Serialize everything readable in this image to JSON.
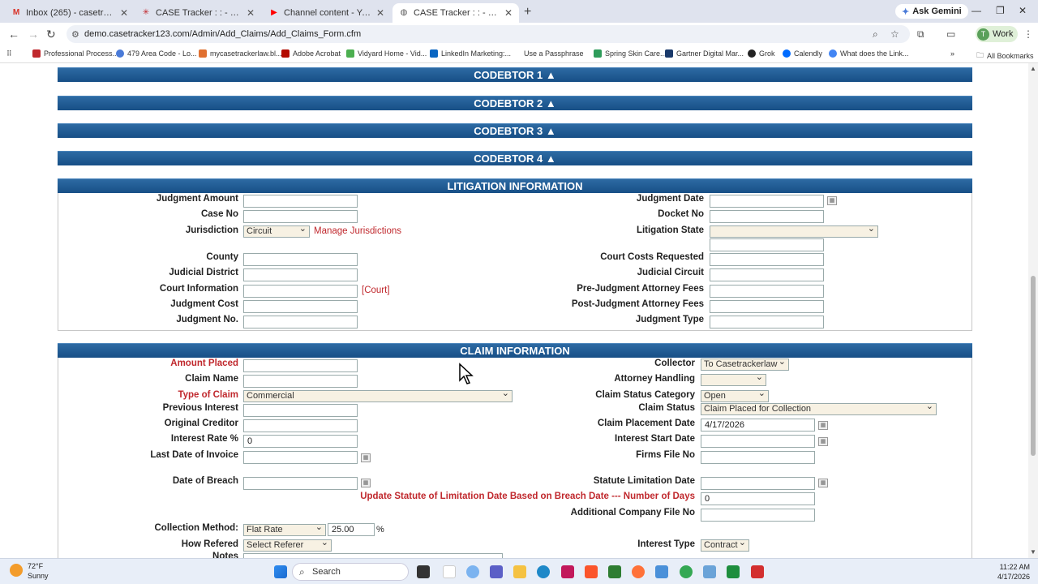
{
  "browser": {
    "tabs": [
      {
        "title": "Inbox (265) - casetrackerlaw@g",
        "icon": "gmail-icon",
        "color": "#d93025"
      },
      {
        "title": "CASE Tracker : : - - - - - - - - - - -",
        "icon": "casetracker-icon",
        "color": "#c0282d"
      },
      {
        "title": "Channel content - YouTube Stu",
        "icon": "youtube-icon",
        "color": "#ff0000"
      },
      {
        "title": "CASE Tracker : : - - - - - - - - - - -",
        "icon": "globe-icon",
        "color": "#555555"
      }
    ],
    "ask_gemini": "Ask Gemini",
    "url": "demo.casetracker123.com/Admin/Add_Claims/Add_Claims_Form.cfm",
    "profile": "Work",
    "profile_initial": "T",
    "bookmarks": [
      "Professional Process...",
      "479 Area Code - Lo...",
      "mycasetrackerlaw.bl...",
      "Adobe Acrobat",
      "Vidyard Home - Vid...",
      "LinkedIn Marketing:...",
      "Use a Passphrase",
      "Spring Skin Care...",
      "Gartner Digital Mar...",
      "Grok",
      "Calendly",
      "What does the Link..."
    ],
    "all_bookmarks": "All Bookmarks"
  },
  "sections": {
    "codebtor1": "CODEBTOR 1 ▲",
    "codebtor2": "CODEBTOR 2 ▲",
    "codebtor3": "CODEBTOR 3 ▲",
    "codebtor4": "CODEBTOR 4 ▲",
    "litigation": "LITIGATION INFORMATION",
    "claim": "CLAIM INFORMATION"
  },
  "litigation": {
    "judgment_amount": "Judgment Amount",
    "case_no": "Case No",
    "jurisdiction": "Jurisdiction",
    "jurisdiction_value": "Circuit",
    "manage_jurisdictions": "Manage Jurisdictions",
    "county": "County",
    "judicial_district": "Judicial District",
    "court_information": "Court Information",
    "court_link": "[Court]",
    "judgment_cost": "Judgment Cost",
    "judgment_no": "Judgment No.",
    "judgment_date": "Judgment Date",
    "docket_no": "Docket No",
    "litigation_state": "Litigation State",
    "court_costs_requested": "Court Costs Requested",
    "judicial_circuit": "Judicial Circuit",
    "pre_judgment_fees": "Pre-Judgment Attorney Fees",
    "post_judgment_fees": "Post-Judgment Attorney Fees",
    "judgment_type": "Judgment Type"
  },
  "claim": {
    "amount_placed": "Amount Placed",
    "claim_name": "Claim Name",
    "type_of_claim": "Type of Claim",
    "type_of_claim_value": "Commercial",
    "previous_interest": "Previous Interest",
    "original_creditor": "Original Creditor",
    "interest_rate": "Interest Rate %",
    "interest_rate_value": "0",
    "last_date_invoice": "Last Date of Invoice",
    "date_of_breach": "Date of Breach",
    "collection_method": "Collection Method:",
    "collection_method_value": "Flat Rate",
    "collection_rate_value": "25.00",
    "percent": "%",
    "how_refered": "How Refered",
    "how_refered_value": "Select Referer",
    "notes": "Notes",
    "collector": "Collector",
    "collector_value": "To Casetrackerlaw",
    "attorney_handling": "Attorney Handling",
    "status_category": "Claim Status Category",
    "status_category_value": "Open",
    "claim_status": "Claim Status",
    "claim_status_value": "Claim Placed for Collection",
    "placement_date": "Claim Placement Date",
    "placement_date_value": "4/17/2026",
    "interest_start_date": "Interest Start Date",
    "firms_file_no": "Firms File No",
    "statute_limitation_date": "Statute Limitation Date",
    "update_statute": "Update Statute of Limitation Date Based on Breach Date --- Number of Days",
    "number_of_days_value": "0",
    "additional_file_no": "Additional Company File No",
    "interest_type": "Interest Type",
    "interest_type_value": "Contract"
  },
  "taskbar": {
    "temp": "72°F",
    "condition": "Sunny",
    "search": "Search",
    "time": "11:22 AM",
    "date": "4/17/2026"
  }
}
